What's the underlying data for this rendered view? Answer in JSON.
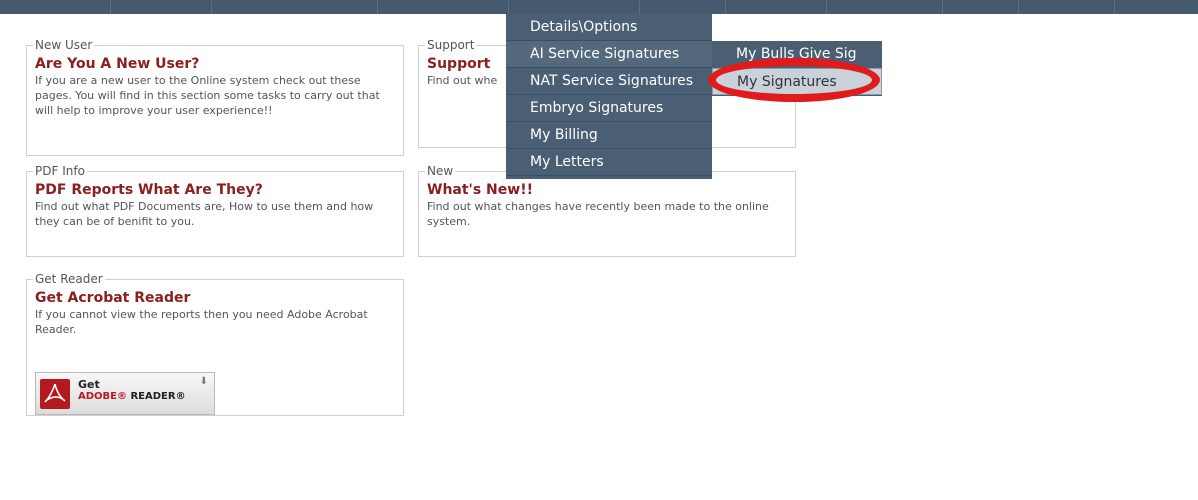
{
  "panels": {
    "new_user": {
      "legend": "New User",
      "title": "Are You A New User?",
      "description": "If you are a new user to the Online system check out these pages. You will find in this section some tasks to carry out that will help to improve your user experience!!"
    },
    "support": {
      "legend": "Support",
      "title": "Support",
      "description": "Find out whe"
    },
    "pdf_info": {
      "legend": "PDF Info",
      "title": "PDF Reports What Are They?",
      "description": "Find out what PDF Documents are, How to use them and how they can be of benifit to you."
    },
    "new": {
      "legend": "New",
      "title": "What's New!!",
      "description": "Find out what changes have recently been made to the online system."
    },
    "get_reader": {
      "legend": "Get Reader",
      "title": "Get Acrobat Reader",
      "description": "If you cannot view the reports then you need Adobe Acrobat Reader.",
      "button": {
        "get": "Get",
        "brand": "ADOBE®",
        "product": "READER®"
      }
    }
  },
  "dropdown": {
    "items": [
      "Details\\Options",
      "AI Service Signatures",
      "NAT Service Signatures",
      "Embryo Signatures",
      "My Billing",
      "My Letters"
    ]
  },
  "submenu": {
    "items": [
      "My Bulls Give Sig",
      "My Signatures"
    ],
    "active_index": 1
  },
  "colors": {
    "nav_bg": "#4a5f73",
    "title_red": "#8b1e1e",
    "annotation_red": "#e11b1b"
  }
}
